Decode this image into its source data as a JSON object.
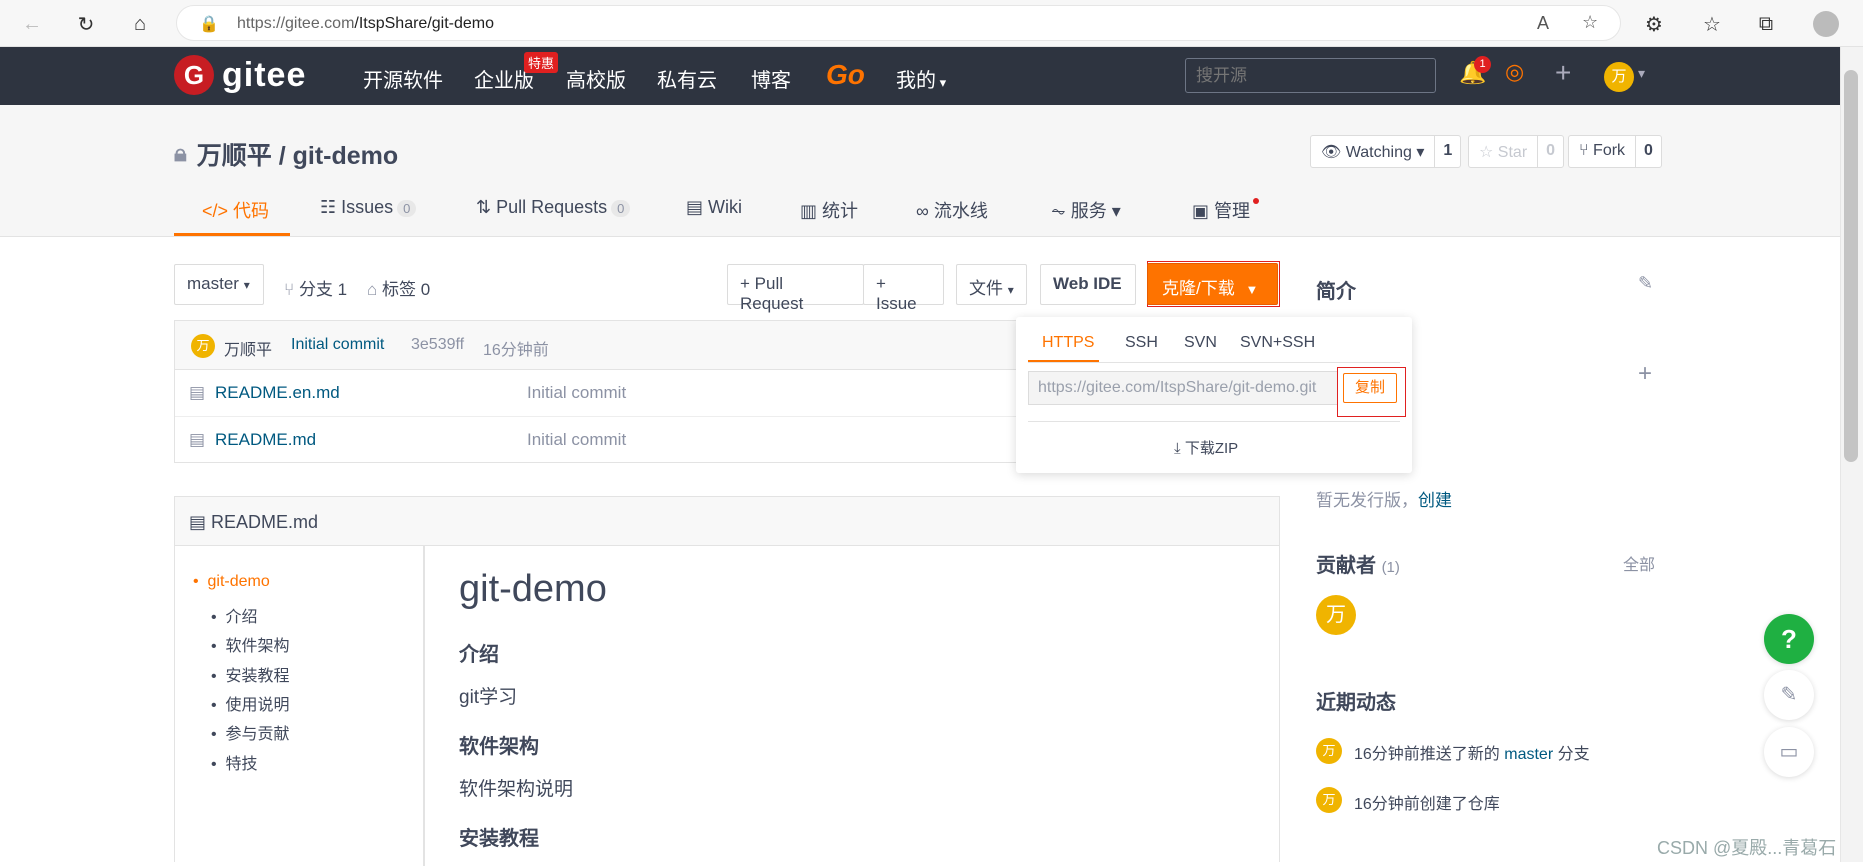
{
  "browser": {
    "url_host": "https://gitee.com",
    "url_path": "/ItspShare/git-demo"
  },
  "header": {
    "logo_letter": "G",
    "logo_text": "gitee",
    "nav": [
      "开源软件",
      "企业版",
      "高校版",
      "私有云",
      "博客"
    ],
    "nav_badge": "特惠",
    "go": "Go",
    "mine": "我的",
    "search_placeholder": "搜开源",
    "notification_count": "1",
    "user_avatar": "万"
  },
  "project": {
    "title": "万顺平 / git-demo",
    "watching_label": "Watching",
    "watching_count": "1",
    "star_label": "Star",
    "star_count": "0",
    "fork_label": "Fork",
    "fork_count": "0",
    "tabs": {
      "code": "代码",
      "issues": "Issues",
      "issues_count": "0",
      "pr": "Pull Requests",
      "pr_count": "0",
      "wiki": "Wiki",
      "stats": "统计",
      "pipeline": "流水线",
      "service": "服务",
      "manage": "管理"
    }
  },
  "toolbar": {
    "branch": "master",
    "branches": "分支 1",
    "tags": "标签 0",
    "new_pr": "+ Pull Request",
    "new_issue": "+ Issue",
    "file": "文件",
    "web_ide": "Web IDE",
    "clone": "克隆/下载"
  },
  "commit": {
    "avatar": "万",
    "author": "万顺平",
    "message": "Initial commit",
    "hash": "3e539ff",
    "time": "16分钟前"
  },
  "files": [
    {
      "name": "README.en.md",
      "message": "Initial commit"
    },
    {
      "name": "README.md",
      "message": "Initial commit"
    }
  ],
  "clone_panel": {
    "tabs": [
      "HTTPS",
      "SSH",
      "SVN",
      "SVN+SSH"
    ],
    "url": "https://gitee.com/ItspShare/git-demo.git",
    "copy": "复制",
    "download_zip": "下载ZIP"
  },
  "readme": {
    "filename": "README.md",
    "toc": [
      "git-demo",
      "介绍",
      "软件架构",
      "安装教程",
      "使用说明",
      "参与贡献",
      "特技"
    ],
    "h1": "git-demo",
    "h_intro": "介绍",
    "p_intro": "git学习",
    "h_arch": "软件架构",
    "p_arch": "软件架构说明",
    "h_install": "安装教程"
  },
  "sidebar": {
    "intro_title": "简介",
    "no_release": "暂无发行版，",
    "create": "创建",
    "contributors_title": "贡献者",
    "contributors_count": "(1)",
    "all": "全部",
    "contributor_avatar": "万",
    "activity_title": "近期动态",
    "activity": [
      {
        "avatar": "万",
        "pre": "16分钟前推送了新的 ",
        "branch": "master",
        "post": " 分支"
      },
      {
        "avatar": "万",
        "text": "16分钟前创建了仓库"
      }
    ]
  },
  "watermark": "CSDN @夏殿...青葛石",
  "colors": {
    "accent": "#fe7300",
    "header_bg": "#2e3440",
    "link": "#005980",
    "fab_help": "#1fb042"
  }
}
